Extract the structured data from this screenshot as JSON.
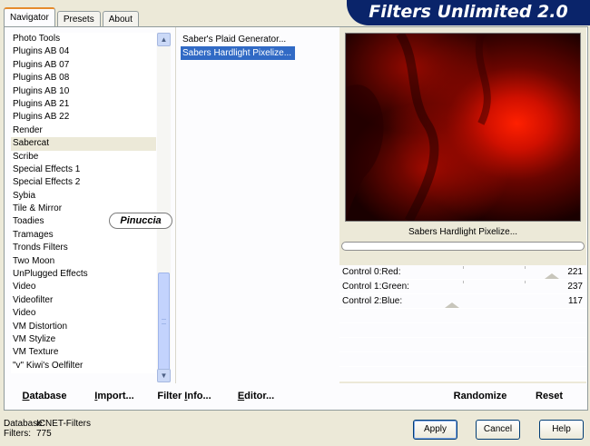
{
  "tabs": [
    {
      "label": "Navigator",
      "active": true
    },
    {
      "label": "Presets",
      "active": false
    },
    {
      "label": "About",
      "active": false
    }
  ],
  "banner": {
    "title": "Filters Unlimited 2.0"
  },
  "categories": {
    "items": [
      "Photo Tools",
      "Plugins AB 04",
      "Plugins AB 07",
      "Plugins AB 08",
      "Plugins AB 10",
      "Plugins AB 21",
      "Plugins AB 22",
      "Render",
      "Sabercat",
      "Scribe",
      "Special Effects 1",
      "Special Effects 2",
      "Sybia",
      "Tile & Mirror",
      "Toadies",
      "Tramages",
      "Tronds Filters",
      "Two Moon",
      "UnPlugged Effects",
      "Video",
      "Videofilter",
      "Video",
      "VM Distortion",
      "VM Stylize",
      "VM Texture",
      "\"v\" Kiwi's Oelfilter"
    ],
    "selected": "Sabercat"
  },
  "filters": {
    "items": [
      "Saber's Plaid Generator...",
      "Sabers Hardlight Pixelize..."
    ],
    "selected": "Sabers Hardlight Pixelize..."
  },
  "preview": {
    "label": "Sabers Hardlight Pixelize..."
  },
  "controls": [
    {
      "label": "Control 0:Red:",
      "value": "221"
    },
    {
      "label": "Control 1:Green:",
      "value": "237"
    },
    {
      "label": "Control 2:Blue:",
      "value": "117"
    }
  ],
  "toolbar": {
    "database": {
      "pre": "",
      "u": "D",
      "post": "atabase"
    },
    "import": {
      "pre": "",
      "u": "I",
      "post": "mport..."
    },
    "filter_info": {
      "pre": "Filter ",
      "u": "I",
      "post": "nfo..."
    },
    "editor": {
      "pre": "",
      "u": "E",
      "post": "ditor..."
    },
    "randomize": "Randomize",
    "reset": "Reset"
  },
  "status": {
    "database_key": "Database:",
    "database_value": "ICNET-Filters",
    "filters_key": "Filters:",
    "filters_value": "775"
  },
  "dialog": {
    "apply": "Apply",
    "cancel": "Cancel",
    "help": "Help"
  },
  "watermark": "Pinuccia",
  "colors": {
    "banner": "#0a246a",
    "selection": "#316ac5",
    "preview_red": "#e01000"
  }
}
